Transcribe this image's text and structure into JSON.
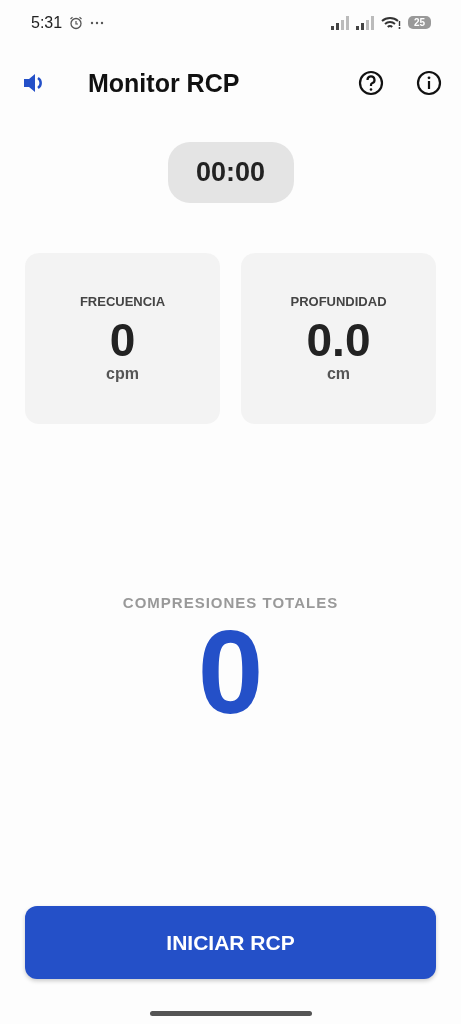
{
  "status_bar": {
    "time": "5:31",
    "battery": "25"
  },
  "header": {
    "title": "Monitor RCP"
  },
  "timer": "00:00",
  "metrics": [
    {
      "label": "FRECUENCIA",
      "value": "0",
      "unit": "cpm"
    },
    {
      "label": "PROFUNDIDAD",
      "value": "0.0",
      "unit": "cm"
    }
  ],
  "total": {
    "label": "COMPRESIONES TOTALES",
    "value": "0"
  },
  "start_button": "INICIAR RCP"
}
